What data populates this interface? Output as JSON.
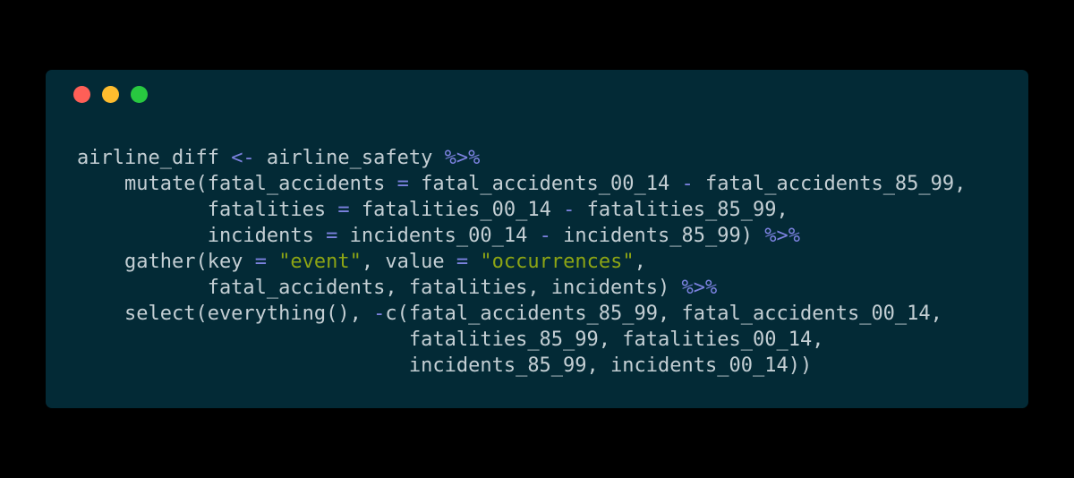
{
  "window": {
    "background": "#032a36",
    "controls": [
      {
        "name": "close",
        "color": "#ff5f57"
      },
      {
        "name": "minimize",
        "color": "#febc2e"
      },
      {
        "name": "maximize",
        "color": "#28c840"
      }
    ]
  },
  "colors": {
    "plain": "#c4cfd4",
    "operator": "#7c82e0",
    "string": "#8da514"
  },
  "code": {
    "language": "R",
    "lines": [
      [
        {
          "t": "plain",
          "v": "airline_diff "
        },
        {
          "t": "op",
          "v": "<-"
        },
        {
          "t": "plain",
          "v": " airline_safety "
        },
        {
          "t": "op",
          "v": "%>%"
        }
      ],
      [
        {
          "t": "plain",
          "v": "    mutate(fatal_accidents "
        },
        {
          "t": "op",
          "v": "="
        },
        {
          "t": "plain",
          "v": " fatal_accidents_00_14 "
        },
        {
          "t": "op",
          "v": "-"
        },
        {
          "t": "plain",
          "v": " fatal_accidents_85_99,"
        }
      ],
      [
        {
          "t": "plain",
          "v": "           fatalities "
        },
        {
          "t": "op",
          "v": "="
        },
        {
          "t": "plain",
          "v": " fatalities_00_14 "
        },
        {
          "t": "op",
          "v": "-"
        },
        {
          "t": "plain",
          "v": " fatalities_85_99,"
        }
      ],
      [
        {
          "t": "plain",
          "v": "           incidents "
        },
        {
          "t": "op",
          "v": "="
        },
        {
          "t": "plain",
          "v": " incidents_00_14 "
        },
        {
          "t": "op",
          "v": "-"
        },
        {
          "t": "plain",
          "v": " incidents_85_99) "
        },
        {
          "t": "op",
          "v": "%>%"
        }
      ],
      [
        {
          "t": "plain",
          "v": "    gather(key "
        },
        {
          "t": "op",
          "v": "="
        },
        {
          "t": "plain",
          "v": " "
        },
        {
          "t": "str",
          "v": "\"event\""
        },
        {
          "t": "plain",
          "v": ", value "
        },
        {
          "t": "op",
          "v": "="
        },
        {
          "t": "plain",
          "v": " "
        },
        {
          "t": "str",
          "v": "\"occurrences\""
        },
        {
          "t": "plain",
          "v": ","
        }
      ],
      [
        {
          "t": "plain",
          "v": "           fatal_accidents, fatalities, incidents) "
        },
        {
          "t": "op",
          "v": "%>%"
        }
      ],
      [
        {
          "t": "plain",
          "v": "    select(everything(), "
        },
        {
          "t": "op",
          "v": "-"
        },
        {
          "t": "plain",
          "v": "c(fatal_accidents_85_99, fatal_accidents_00_14,"
        }
      ],
      [
        {
          "t": "plain",
          "v": "                            fatalities_85_99, fatalities_00_14,"
        }
      ],
      [
        {
          "t": "plain",
          "v": "                            incidents_85_99, incidents_00_14))"
        }
      ]
    ]
  }
}
